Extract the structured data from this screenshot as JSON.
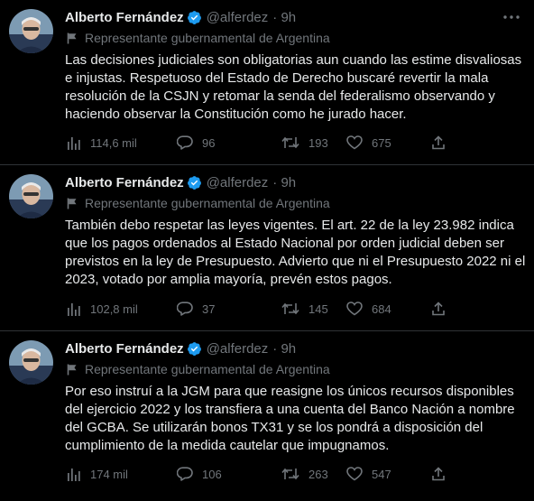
{
  "colors": {
    "background": "#000000",
    "text": "#e7e9ea",
    "muted": "#71767b",
    "verified": "#1d9bf0",
    "divider": "#2f3336"
  },
  "tweets": [
    {
      "author": "Alberto Fernández",
      "handle": "@alferdez",
      "time": "· 9h",
      "label": "Representante gubernamental de Argentina",
      "text": "Las decisiones judiciales son obligatorias aun cuando las estime disvaliosas e injustas. Respetuoso del Estado de Derecho buscaré revertir la mala resolución de la CSJN y retomar la senda del federalismo observando y haciendo observar la Constitución como he jurado hacer.",
      "views": "114,6 mil",
      "replies": "96",
      "retweets": "193",
      "likes": "675"
    },
    {
      "author": "Alberto Fernández",
      "handle": "@alferdez",
      "time": "· 9h",
      "label": "Representante gubernamental de Argentina",
      "text": "También debo respetar las leyes vigentes. El art. 22 de la ley 23.982 indica que los pagos ordenados al Estado Nacional por orden judicial deben ser previstos en la ley de Presupuesto. Advierto que ni el Presupuesto 2022 ni el 2023, votado por amplia mayoría, prevén estos pagos.",
      "views": "102,8 mil",
      "replies": "37",
      "retweets": "145",
      "likes": "684"
    },
    {
      "author": "Alberto Fernández",
      "handle": "@alferdez",
      "time": "· 9h",
      "label": "Representante gubernamental de Argentina",
      "text": "Por eso instruí a la JGM para que reasigne los únicos recursos disponibles del ejercicio 2022 y los transfiera a una cuenta del Banco Nación a nombre del GCBA. Se utilizarán bonos TX31 y se los pondrá a disposición del cumplimiento de la medida cautelar que impugnamos.",
      "views": "174 mil",
      "replies": "106",
      "retweets": "263",
      "likes": "547"
    }
  ]
}
